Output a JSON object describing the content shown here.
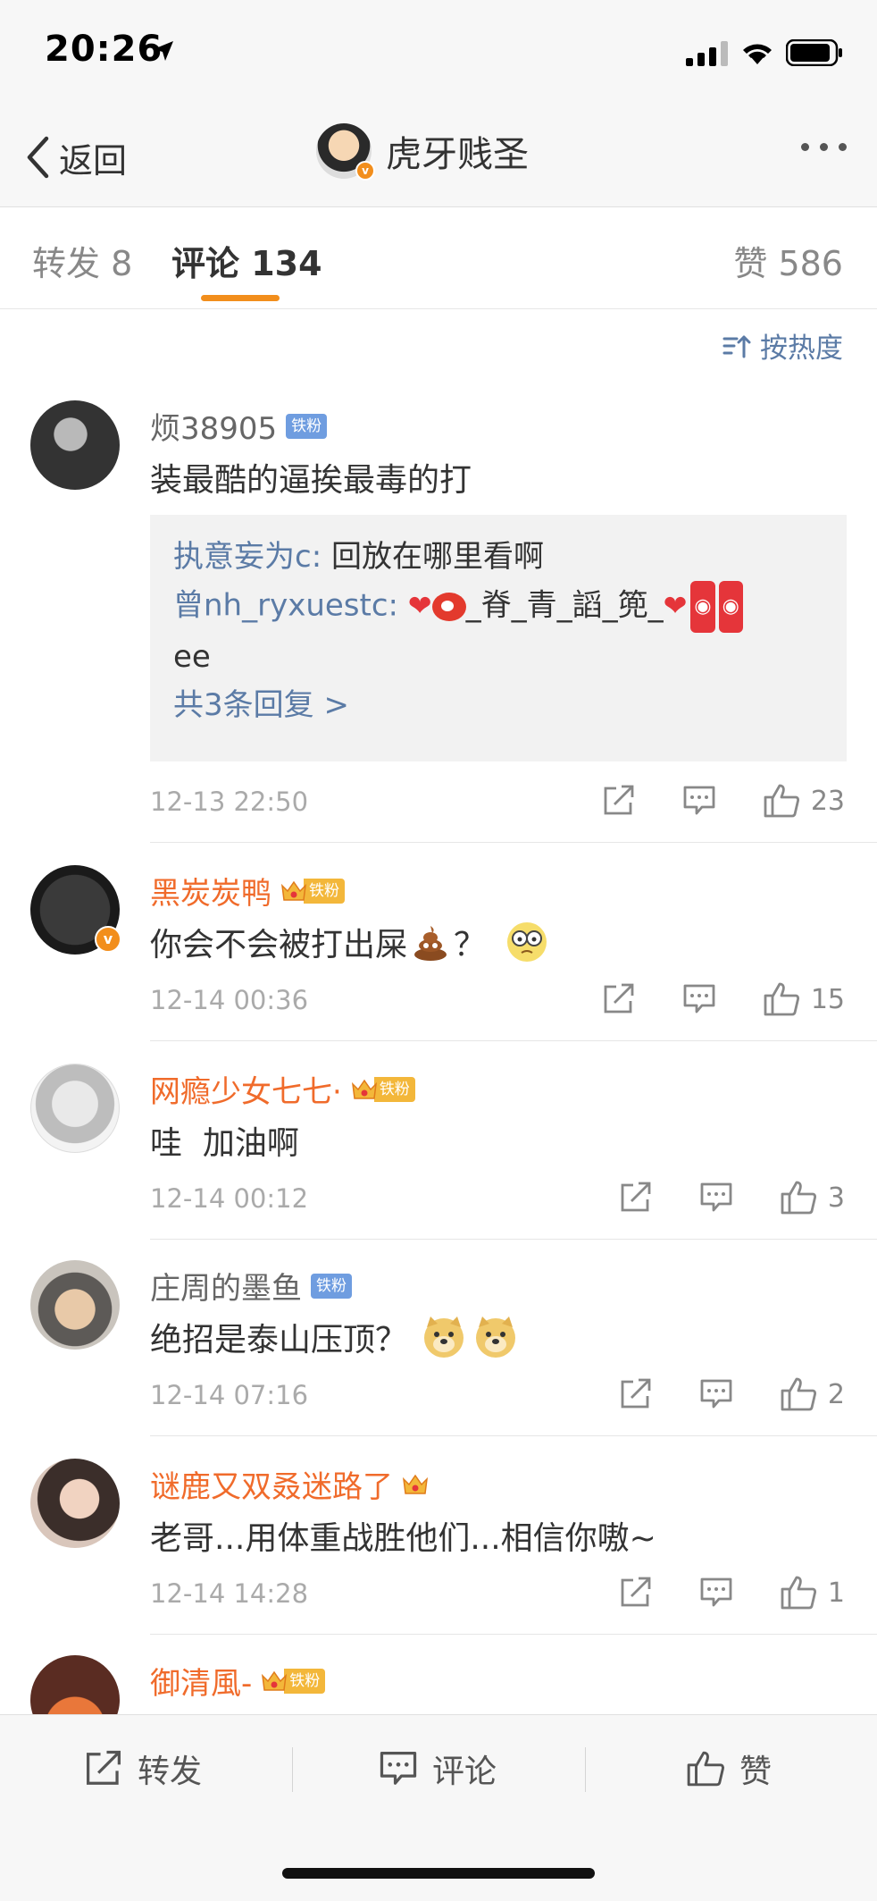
{
  "status_bar": {
    "time": "20:26"
  },
  "nav": {
    "back_label": "返回",
    "title": "虎牙贱圣"
  },
  "tabs": {
    "repost": "转发 8",
    "comment": "评论 134",
    "like": "赞 586"
  },
  "sort_label": "按热度",
  "comments": [
    {
      "username": "烦38905",
      "badge": "铁粉",
      "text": "装最酷的逼挨最毒的打",
      "replies": [
        {
          "name": "执意妄为c:",
          "text": "回放在哪里看啊"
        },
        {
          "name": "曾nh_ryxuestc:",
          "text_part1": "_脊_青_謟_篼_",
          "text_part2": "ee"
        }
      ],
      "more_replies": "共3条回复 >",
      "time": "12-13 22:50",
      "likes": "23"
    },
    {
      "username": "黑炭炭鸭",
      "badge": "铁粉",
      "text": "你会不会被打出屎",
      "text_suffix": "？",
      "time": "12-14 00:36",
      "likes": "15"
    },
    {
      "username": "网瘾少女七七·",
      "badge": "铁粉",
      "text": "哇  加油啊",
      "time": "12-14 00:12",
      "likes": "3"
    },
    {
      "username": "庄周的墨鱼",
      "badge": "铁粉",
      "text": "绝招是泰山压顶？",
      "time": "12-14 07:16",
      "likes": "2"
    },
    {
      "username": "谜鹿又双叒迷路了",
      "text": "老哥...用体重战胜他们...相信你嗷~",
      "time": "12-14 14:28",
      "likes": "1"
    },
    {
      "username": "御清風-",
      "badge": "铁粉"
    }
  ],
  "bottom_bar": {
    "repost": "转发",
    "comment": "评论",
    "like": "赞"
  }
}
